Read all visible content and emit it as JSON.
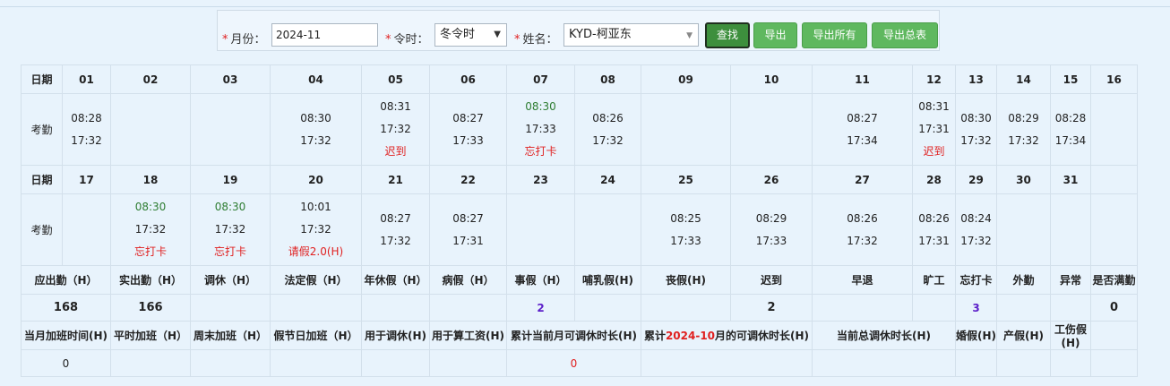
{
  "filters": {
    "month_label": "月份：",
    "month_value": "2024-11",
    "period_label": "令时：",
    "period_value": "冬令时",
    "name_label": "姓名：",
    "name_value": "KYD-柯亚东",
    "required_mark": "*"
  },
  "buttons": {
    "search": "查找",
    "export": "导出",
    "export_all": "导出所有",
    "export_summary": "导出总表"
  },
  "calendar": {
    "date_label": "日期",
    "attendance_label": "考勤",
    "week1_days": [
      "01",
      "02",
      "03",
      "04",
      "05",
      "06",
      "07",
      "08",
      "09",
      "10",
      "11",
      "12",
      "13",
      "14",
      "15",
      "16"
    ],
    "week1_in": [
      "08:28",
      "",
      "",
      "08:30",
      "08:31",
      "08:27",
      "08:30",
      "08:26",
      "",
      "",
      "08:27",
      "08:31",
      "08:30",
      "08:29",
      "08:28",
      ""
    ],
    "week1_out": [
      "17:32",
      "",
      "",
      "17:32",
      "17:32",
      "17:33",
      "17:33",
      "17:32",
      "",
      "",
      "17:34",
      "17:31",
      "17:32",
      "17:32",
      "17:34",
      ""
    ],
    "week1_note": [
      "",
      "",
      "",
      "",
      "迟到",
      "",
      "忘打卡",
      "",
      "",
      "",
      "",
      "迟到",
      "",
      "",
      "",
      ""
    ],
    "week2_days": [
      "17",
      "18",
      "19",
      "20",
      "21",
      "22",
      "23",
      "24",
      "25",
      "26",
      "27",
      "28",
      "29",
      "30",
      "31",
      ""
    ],
    "week2_in": [
      "",
      "08:30",
      "08:30",
      "10:01",
      "08:27",
      "08:27",
      "",
      "",
      "08:25",
      "08:29",
      "08:26",
      "08:26",
      "08:24",
      "",
      "",
      ""
    ],
    "week2_out": [
      "",
      "17:32",
      "17:32",
      "17:32",
      "17:32",
      "17:31",
      "",
      "",
      "17:33",
      "17:33",
      "17:32",
      "17:31",
      "17:32",
      "",
      "",
      ""
    ],
    "week2_note": [
      "",
      "忘打卡",
      "忘打卡",
      "请假2.0(H)",
      "",
      "",
      "",
      "",
      "",
      "",
      "",
      "",
      "",
      "",
      "",
      ""
    ]
  },
  "colors": {
    "green_punch": "#2e7d32",
    "red_note": "#e02020",
    "purple_value": "#5c1fc9"
  },
  "summary": {
    "headers": [
      "应出勤（H）",
      "实出勤（H）",
      "调休（H）",
      "法定假（H）",
      "年休假（H）",
      "病假（H）",
      "事假（H）",
      "哺乳假(H)",
      "丧假(H)",
      "迟到",
      "早退",
      "旷工",
      "忘打卡",
      "外勤",
      "异常",
      "是否满勤"
    ],
    "values": [
      "168",
      "166",
      "",
      "",
      "",
      "",
      "2",
      "",
      "",
      "2",
      "",
      "",
      "3",
      "",
      "",
      "0"
    ]
  },
  "overtime": {
    "headers": [
      "当月加班时间(H)",
      "平时加班（H）",
      "周末加班（H）",
      "假节日加班（H）",
      "用于调休(H)",
      "用于算工资(H)",
      "累计当前月可调休时长(H)",
      "累计",
      "2024-10",
      "月的可调休时长(H)",
      "当前总调休时长(H)",
      "婚假(H)",
      "产假(H)",
      "工伤假(H)"
    ],
    "values": [
      "0",
      "0"
    ]
  }
}
